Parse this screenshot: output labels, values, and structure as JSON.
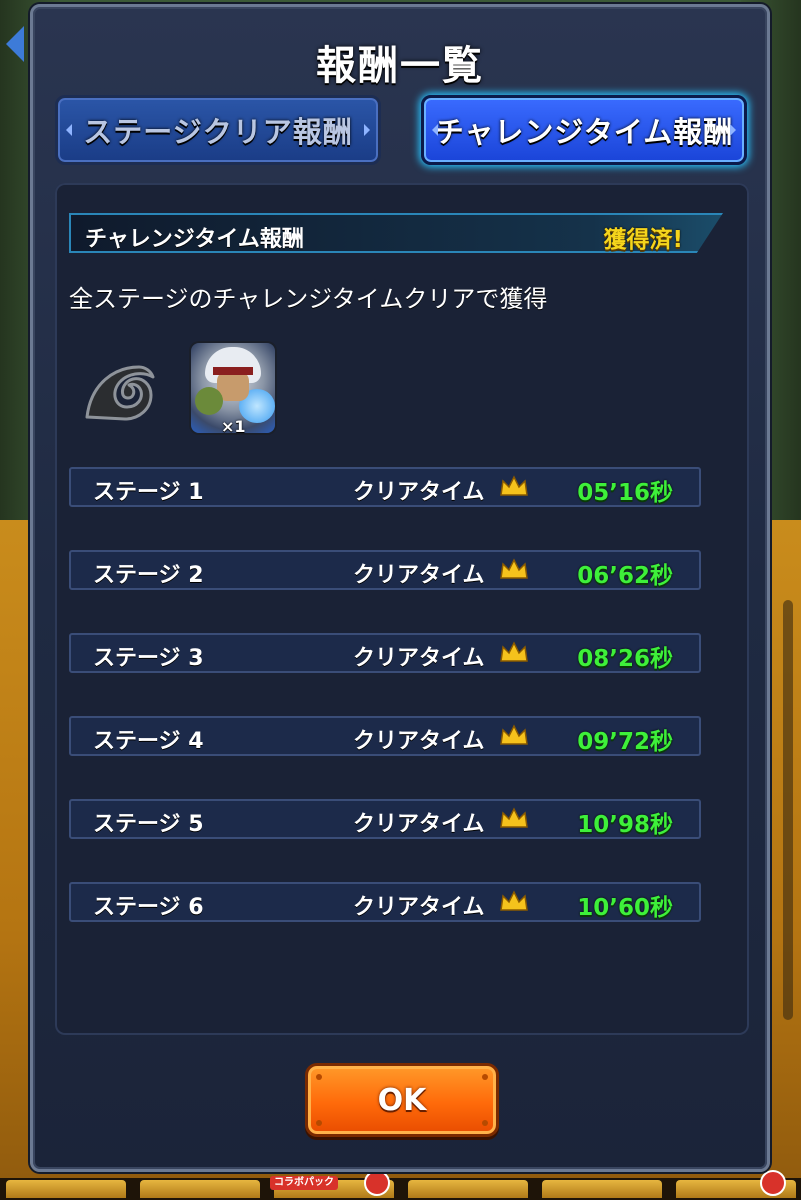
{
  "modal": {
    "title": "報酬一覧",
    "tabs": [
      {
        "label": "ステージクリア報酬",
        "active": false
      },
      {
        "label": "チャレンジタイム報酬",
        "active": true
      }
    ]
  },
  "section": {
    "title": "チャレンジタイム報酬",
    "status": "獲得済!",
    "description": "全ステージのチャレンジタイムクリアで獲得"
  },
  "rewards": [
    {
      "icon": "leaf-village-icon"
    },
    {
      "icon": "character-card-icon",
      "count": "×1"
    }
  ],
  "stages": [
    {
      "label": "ステージ 1",
      "clear_label": "クリアタイム",
      "time": "05’16秒"
    },
    {
      "label": "ステージ 2",
      "clear_label": "クリアタイム",
      "time": "06’62秒"
    },
    {
      "label": "ステージ 3",
      "clear_label": "クリアタイム",
      "time": "08’26秒"
    },
    {
      "label": "ステージ 4",
      "clear_label": "クリアタイム",
      "time": "09’72秒"
    },
    {
      "label": "ステージ 5",
      "clear_label": "クリアタイム",
      "time": "10’98秒"
    },
    {
      "label": "ステージ 6",
      "clear_label": "クリアタイム",
      "time": "10’60秒"
    }
  ],
  "ok_button": {
    "label": "OK"
  },
  "background": {
    "collab_tag": "コラボパック"
  },
  "colors": {
    "time_green": "#3ef03a",
    "status_yellow": "#f5d51c",
    "ok_orange": "#ff6a0a",
    "active_tab_blue": "#1a44d8"
  }
}
